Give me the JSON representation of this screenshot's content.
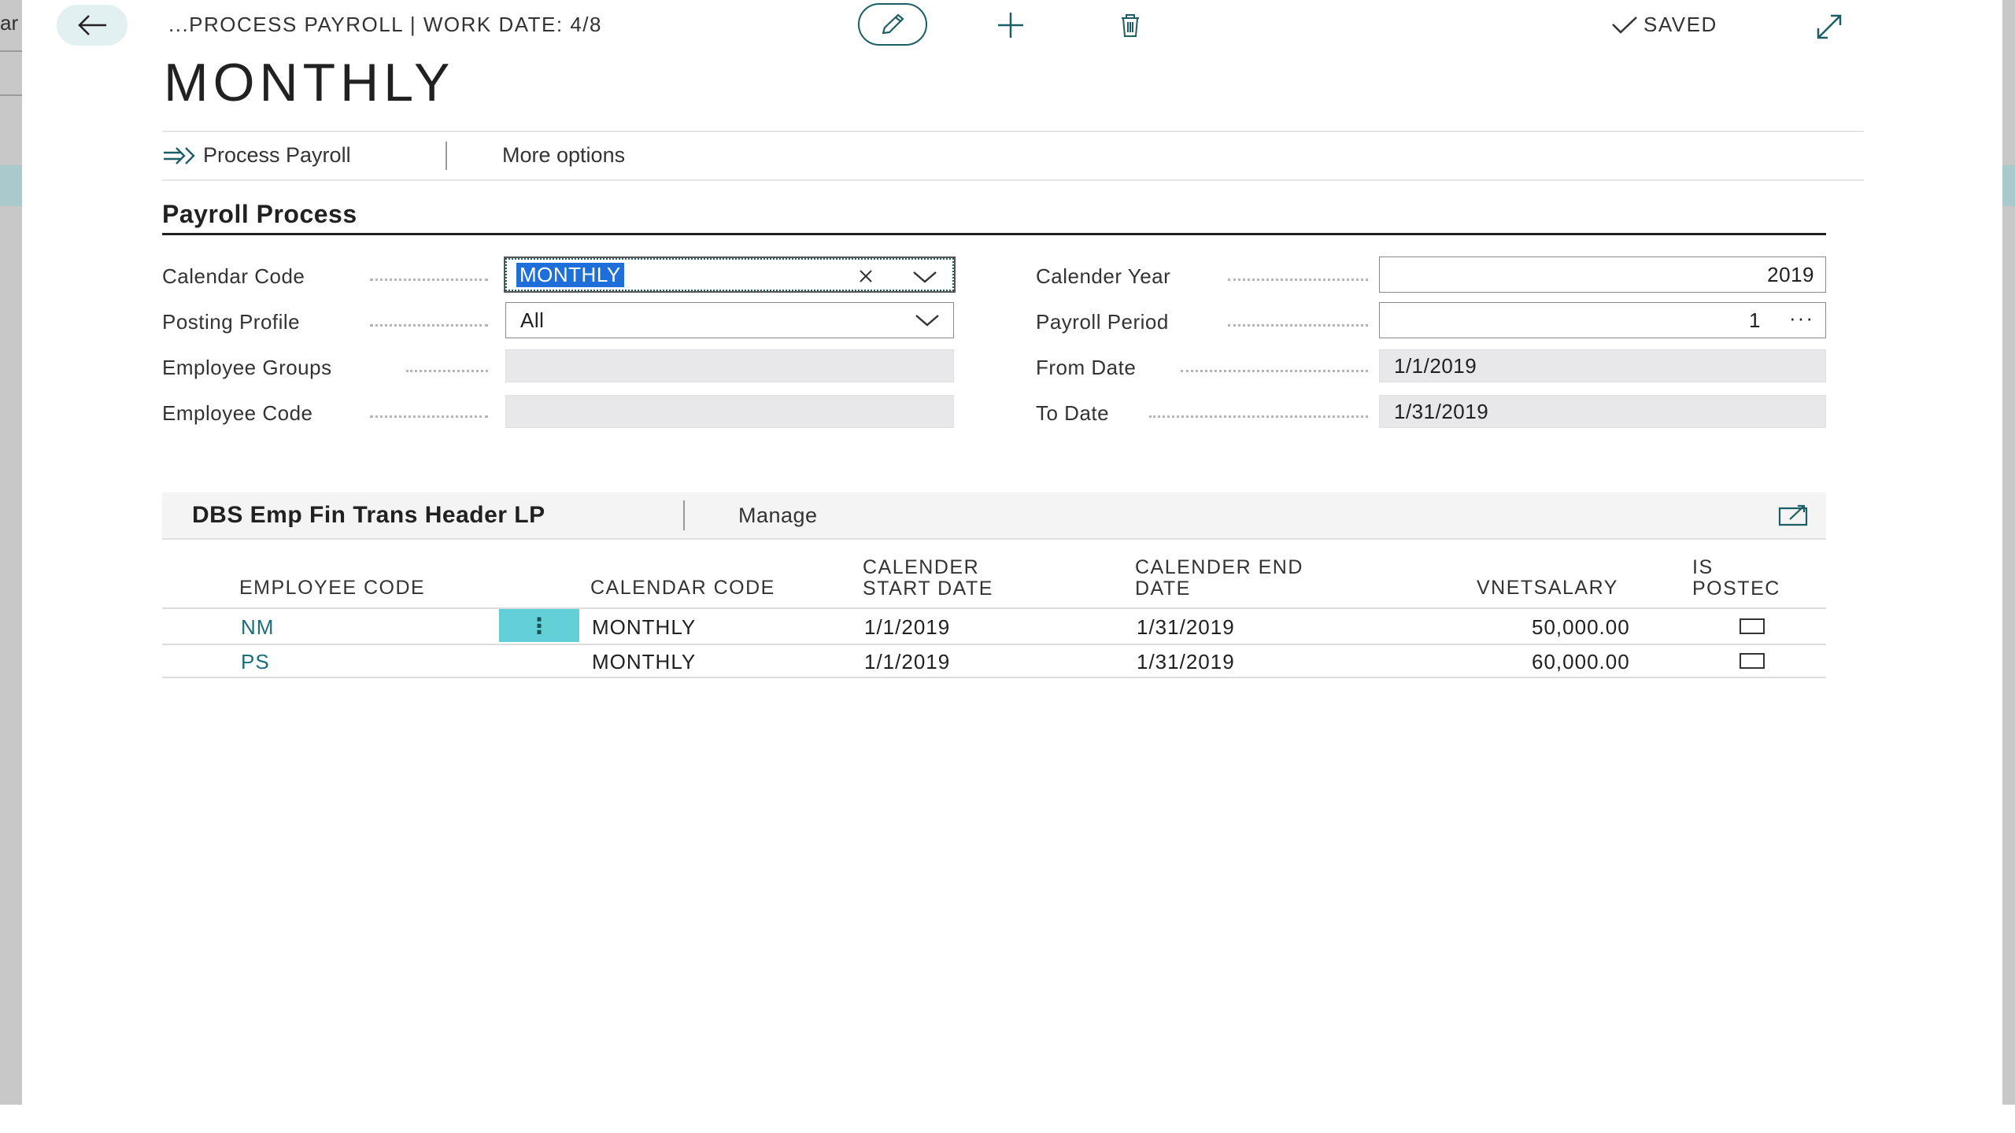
{
  "background": {
    "left_fragment": "ar"
  },
  "header": {
    "breadcrumb": "...PROCESS PAYROLL | WORK DATE: 4/8",
    "status": "SAVED",
    "icons": [
      "back-arrow-icon",
      "pencil-icon",
      "plus-icon",
      "trash-icon",
      "checkmark-icon",
      "expand-icon"
    ]
  },
  "title": "MONTHLY",
  "actions": {
    "process_payroll": "Process Payroll",
    "more_options": "More options"
  },
  "section": {
    "title": "Payroll Process",
    "left_fields": [
      {
        "label": "Calendar Code",
        "value": "MONTHLY"
      },
      {
        "label": "Posting Profile",
        "value": "All"
      },
      {
        "label": "Employee Groups",
        "value": ""
      },
      {
        "label": "Employee Code",
        "value": ""
      }
    ],
    "right_fields": [
      {
        "label": "Calender Year",
        "value": "2019"
      },
      {
        "label": "Payroll Period",
        "value": "1"
      },
      {
        "label": "From Date",
        "value": "1/1/2019"
      },
      {
        "label": "To Date",
        "value": "1/31/2019"
      }
    ]
  },
  "subpage": {
    "title": "DBS Emp Fin Trans Header LP",
    "manage": "Manage",
    "columns": {
      "employee_code": "EMPLOYEE CODE",
      "calendar_code": "CALENDAR CODE",
      "start_date_1": "CALENDER",
      "start_date_2": "START DATE",
      "end_date_1": "CALENDER END",
      "end_date_2": "DATE",
      "net_salary": "VNETSALARY",
      "is_posted_1": "IS",
      "is_posted_2": "POSTEC"
    },
    "rows": [
      {
        "employee_code": "NM",
        "calendar_code": "MONTHLY",
        "start_date": "1/1/2019",
        "end_date": "1/31/2019",
        "net_salary": "50,000.00",
        "is_posted": false
      },
      {
        "employee_code": "PS",
        "calendar_code": "MONTHLY",
        "start_date": "1/1/2019",
        "end_date": "1/31/2019",
        "net_salary": "60,000.00",
        "is_posted": false
      }
    ]
  },
  "colors": {
    "accent": "#1b5e63",
    "selection": "#1e6fd9",
    "row_menu": "#63cfd6",
    "link": "#1b6f7a"
  }
}
